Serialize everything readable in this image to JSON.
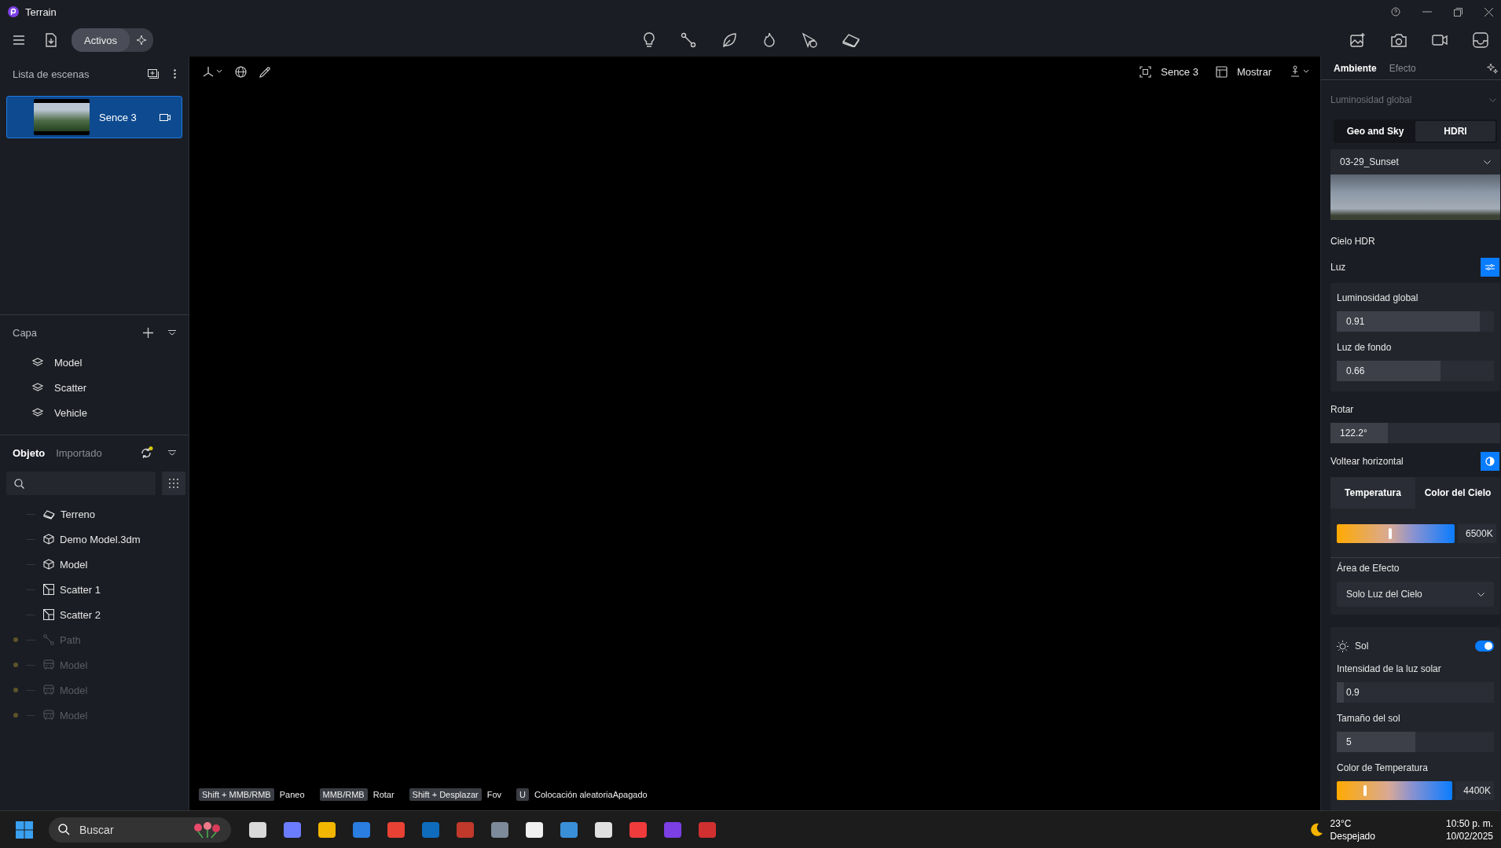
{
  "window": {
    "title": "Terrain"
  },
  "toolbar": {
    "assets_button": "Activos"
  },
  "scene_list": {
    "title": "Lista de escenas",
    "scenes": [
      {
        "name": "Sence 3",
        "selected": true
      }
    ]
  },
  "layers": {
    "title": "Capa",
    "items": [
      "Model",
      "Scatter",
      "Vehicle"
    ]
  },
  "objects": {
    "tabs": [
      {
        "label": "Objeto",
        "selected": true
      },
      {
        "label": "Importado",
        "selected": false
      }
    ],
    "items": [
      {
        "name": "Terreno",
        "kind": "terrain",
        "disabled": false
      },
      {
        "name": "Demo Model.3dm",
        "kind": "model",
        "disabled": false
      },
      {
        "name": "Model",
        "kind": "model",
        "disabled": false
      },
      {
        "name": "Scatter 1",
        "kind": "scatter",
        "disabled": false
      },
      {
        "name": "Scatter 2",
        "kind": "scatter",
        "disabled": false
      },
      {
        "name": "Path",
        "kind": "path",
        "disabled": true
      },
      {
        "name": "Model",
        "kind": "vehicle",
        "disabled": true
      },
      {
        "name": "Model",
        "kind": "vehicle",
        "disabled": true
      },
      {
        "name": "Model",
        "kind": "vehicle",
        "disabled": true
      }
    ]
  },
  "viewport": {
    "scene_label": "Sence 3",
    "show_button": "Mostrar",
    "hints": [
      {
        "key": "Shift + MMB/RMB",
        "label": "Paneo"
      },
      {
        "key": "MMB/RMB",
        "label": "Rotar"
      },
      {
        "key": "Shift + Desplazar",
        "label": "Fov"
      },
      {
        "key": "U",
        "label": "Colocación aleatoriaApagado"
      }
    ]
  },
  "properties": {
    "tabs": [
      {
        "label": "Ambiente",
        "selected": true
      },
      {
        "label": "Efecto",
        "selected": false
      }
    ],
    "section_title": "Luminosidad global",
    "sky_modes": [
      {
        "label": "Geo and Sky",
        "selected": false
      },
      {
        "label": "HDRI",
        "selected": true
      }
    ],
    "hdri_preset": "03-29_Sunset",
    "hdri_label": "Cielo HDR",
    "light_label": "Luz",
    "light_adjust_on": true,
    "light_sliders": [
      {
        "label": "Luminosidad global",
        "value": "0.91",
        "level": 0.91
      },
      {
        "label": "Luz de fondo",
        "value": "0.66",
        "level": 0.66
      }
    ],
    "rotate": {
      "label": "Rotar",
      "value": "122.2°",
      "level": 0.34
    },
    "flip": {
      "label": "Voltear horizontal",
      "on": true
    },
    "color_tabs": [
      {
        "label": "Temperatura",
        "selected": true
      },
      {
        "label": "Color del Cielo",
        "selected": false
      }
    ],
    "sky_temperature": {
      "level": 0.45,
      "reading": "6500K"
    },
    "effect_area": {
      "label": "Área de Efecto",
      "value": "Solo Luz del Cielo"
    },
    "sun": {
      "label": "Sol",
      "on": true,
      "sliders": [
        {
          "label": "Intensidad de la luz solar",
          "value": "0.9",
          "level": 0.045
        },
        {
          "label": "Tamaño del sol",
          "value": "5",
          "level": 0.5
        }
      ],
      "temperature": {
        "label": "Color de Temperatura",
        "level": 0.244,
        "reading": "4400K"
      }
    }
  },
  "taskbar": {
    "search_placeholder": "Buscar",
    "weather": {
      "temperature": "23°C",
      "condition": "Despejado"
    },
    "time": "10:50 p. m.",
    "date": "10/02/2025"
  }
}
